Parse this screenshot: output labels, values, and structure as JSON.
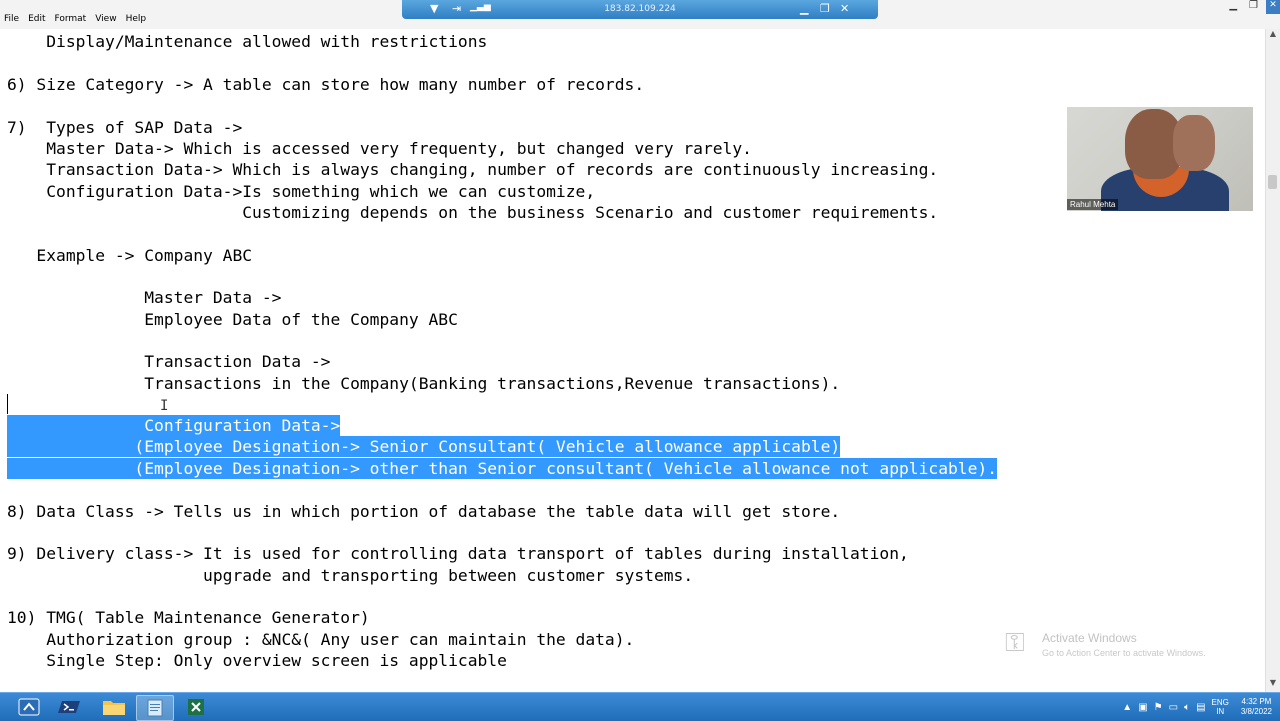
{
  "menu": [
    "File",
    "Edit",
    "Format",
    "View",
    "Help"
  ],
  "connection": {
    "ip": "183.82.109.224"
  },
  "document": {
    "lines": [
      "    Display/Maintenance allowed with restrictions",
      "",
      "6) Size Category -> A table can store how many number of records.",
      "",
      "7)  Types of SAP Data ->",
      "    Master Data-> Which is accessed very frequenty, but changed very rarely.",
      "    Transaction Data-> Which is always changing, number of records are continuously increasing.",
      "    Configuration Data->Is something which we can customize,",
      "                        Customizing depends on the business Scenario and customer requirements.",
      "",
      "   Example -> Company ABC",
      "",
      "              Master Data ->",
      "              Employee Data of the Company ABC",
      "",
      "              Transaction Data ->",
      "              Transactions in the Company(Banking transactions,Revenue transactions).",
      "",
      "              Configuration Data->",
      "             (Employee Designation-> Senior Consultant( Vehicle allowance applicable)",
      "             (Employee Designation-> other than Senior consultant( Vehicle allowance not applicable).",
      "",
      "8) Data Class -> Tells us in which portion of database the table data will get store.",
      "",
      "9) Delivery class-> It is used for controlling data transport of tables during installation,",
      "                    upgrade and transporting between customer systems.",
      "",
      "10) TMG( Table Maintenance Generator)",
      "    Authorization group : &NC&( Any user can maintain the data).",
      "    Single Step: Only overview screen is applicable"
    ],
    "selected_lines": [
      18,
      19,
      20
    ]
  },
  "webcam": {
    "name": "Rahul Mehta"
  },
  "watermark": {
    "title": "Activate Windows",
    "subtitle": "Go to Action Center to activate Windows."
  },
  "taskbar": {
    "apps": [
      "start-icon",
      "powershell-icon",
      "file-explorer-icon",
      "notepad-icon",
      "excel-icon"
    ],
    "lang_top": "ENG",
    "lang_bottom": "IN",
    "time": "4:32 PM",
    "date": "3/8/2022"
  },
  "colors": {
    "selection": "#3399ff",
    "taskbar": "#2b7bc8"
  }
}
